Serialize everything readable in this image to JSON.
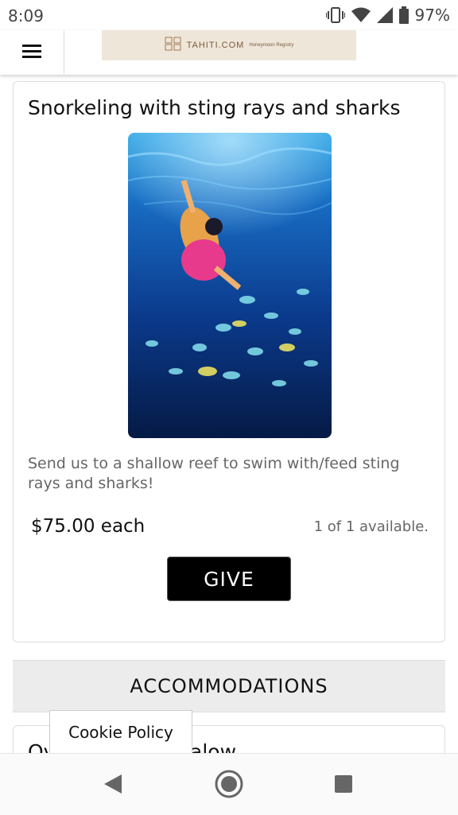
{
  "status": {
    "time": "8:09",
    "battery": "97%"
  },
  "header": {
    "logo_text": "TAHITI.COM",
    "logo_subtext": "Honeymoon Registry"
  },
  "gift": {
    "title": "Snorkeling with sting rays and sharks",
    "description": "Send us to a shallow reef to swim with/feed sting rays and sharks!",
    "price": "$75.00 each",
    "availability": "1 of 1 available.",
    "give_label": "GIVE"
  },
  "section": {
    "title": "ACCOMMODATIONS",
    "next_item_title": "Overwater Bungalow"
  },
  "cookie": {
    "label": "Cookie Policy"
  },
  "colors": {
    "logo_bg": "#efe6da",
    "give_button_bg": "#000000",
    "section_bg": "#ececec"
  }
}
